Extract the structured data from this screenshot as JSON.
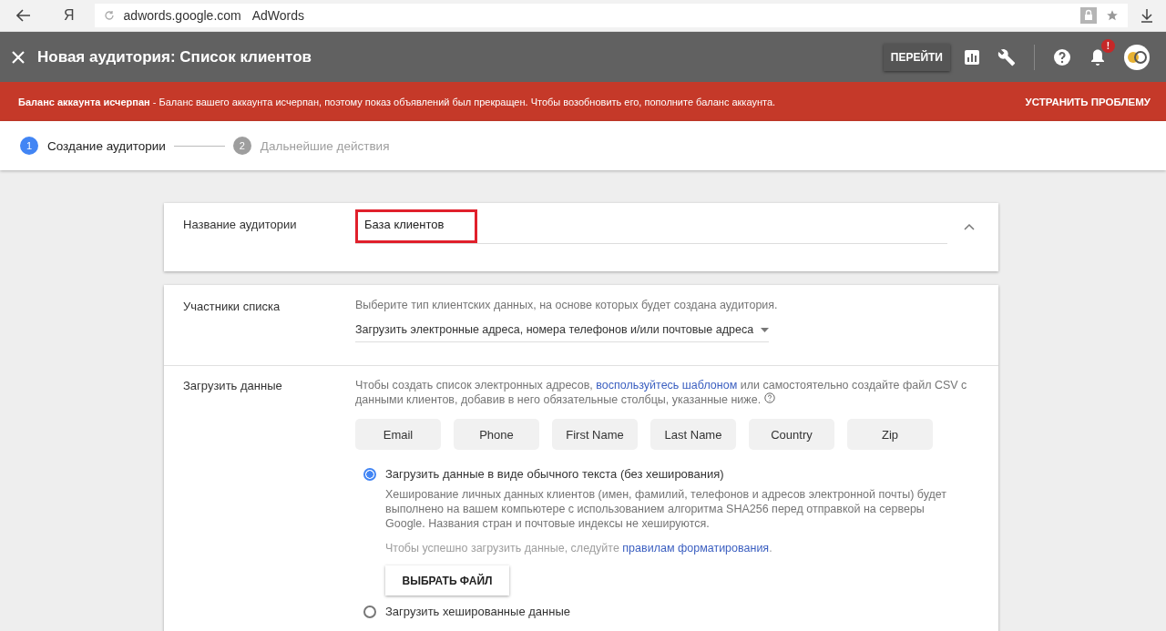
{
  "browser": {
    "logo_letter": "Я",
    "url": "adwords.google.com",
    "page_title": "AdWords"
  },
  "header": {
    "title": "Новая аудитория: Список клиентов",
    "go_button": "ПЕРЕЙТИ",
    "notification_badge": "!"
  },
  "alert": {
    "message": "**Баланс аккаунта исчерпан** - Баланс вашего аккаунта исчерпан, поэтому показ объявлений был прекращен. Чтобы возобновить его, пополните баланс аккаунта.",
    "action": "УСТРАНИТЬ ПРОБЛЕМУ"
  },
  "steps": [
    {
      "number": "1",
      "label": "Создание аудитории",
      "selected": true
    },
    {
      "number": "2",
      "label": "Дальнейшие действия",
      "selected": false
    }
  ],
  "audience_name": {
    "label": "Название аудитории",
    "value": "База клиентов",
    "highlighted": true
  },
  "members": {
    "label": "Участники списка",
    "hint": "Выберите тип клиентских данных, на основе которых будет создана аудитория.",
    "dropdown_value": "Загрузить электронные адреса, номера телефонов и/или почтовые адреса"
  },
  "upload": {
    "label": "Загрузить данные",
    "intro_before": "Чтобы создать список электронных адресов,",
    "intro_link": "воспользуйтесь шаблоном",
    "intro_after": "или самостоятельно создайте файл CSV с данными клиентов, добавив в него обязательные столбцы, указанные ниже.",
    "columns": [
      "Email",
      "Phone",
      "First Name",
      "Last Name",
      "Country",
      "Zip"
    ],
    "options": [
      {
        "label": "Загрузить данные в виде обычного текста (без хеширования)",
        "selected": true,
        "description": "Хеширование личных данных клиентов (имен, фамилий, телефонов и адресов электронной почты) будет выполнено на вашем компьютере с использованием алгоритма SHA256 перед отправкой на серверы Google. Названия стран и почтовые индексы не хешируются.",
        "rules_before": "Чтобы успешно загрузить данные, следуйте",
        "rules_link": "правилам форматирования",
        "rules_after": ".",
        "button": "ВЫБРАТЬ ФАЙЛ"
      },
      {
        "label": "Загрузить хешированные данные",
        "selected": false
      }
    ]
  }
}
